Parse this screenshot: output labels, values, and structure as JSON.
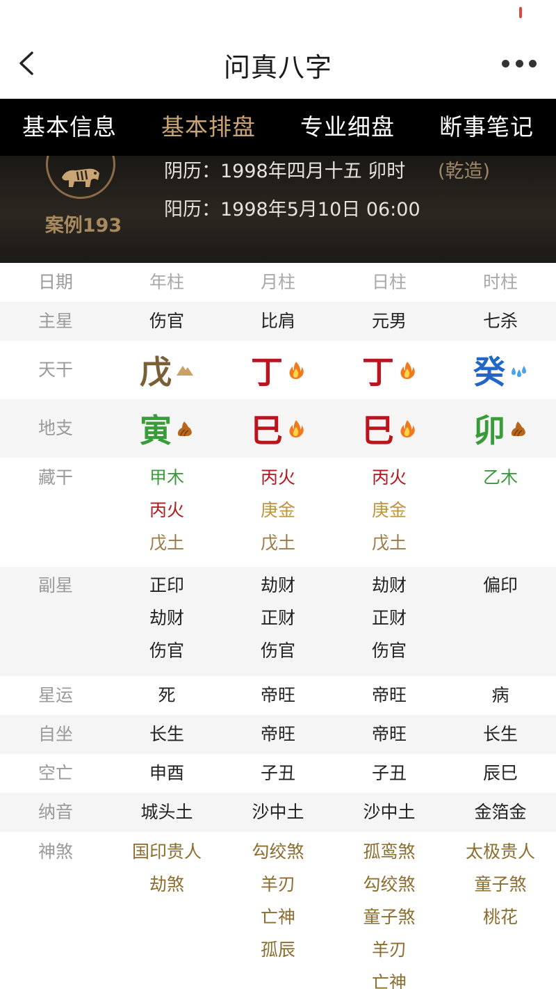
{
  "app": {
    "title": "问真八字"
  },
  "tabs": [
    {
      "label": "基本信息",
      "active": false
    },
    {
      "label": "基本排盘",
      "active": true
    },
    {
      "label": "专业细盘",
      "active": false
    },
    {
      "label": "断事笔记",
      "active": false
    }
  ],
  "header": {
    "case_label": "案例193",
    "lunar_label": "阴历：",
    "lunar_value": "1998年四月十五 卯时",
    "gender": "(乾造)",
    "solar_label": "阳历：",
    "solar_value": "1998年5月10日 06:00"
  },
  "table": {
    "columns_label": "日期",
    "columns": [
      "年柱",
      "月柱",
      "日柱",
      "时柱"
    ],
    "main_star": {
      "label": "主星",
      "values": [
        "伤官",
        "比肩",
        "元男",
        "七杀"
      ]
    },
    "tiangan": {
      "label": "天干",
      "values": [
        {
          "char": "戊",
          "element": "earth",
          "icon": "mountain-icon"
        },
        {
          "char": "丁",
          "element": "fire",
          "icon": "fire-icon"
        },
        {
          "char": "丁",
          "element": "fire",
          "icon": "fire-icon"
        },
        {
          "char": "癸",
          "element": "water",
          "icon": "water-drops-icon"
        }
      ]
    },
    "dizhi": {
      "label": "地支",
      "values": [
        {
          "char": "寅",
          "element": "wood",
          "icon": "wood-icon"
        },
        {
          "char": "巳",
          "element": "fire",
          "icon": "fire-icon"
        },
        {
          "char": "巳",
          "element": "fire",
          "icon": "fire-icon"
        },
        {
          "char": "卯",
          "element": "wood",
          "icon": "wood-icon"
        }
      ]
    },
    "hidden_stems": {
      "label": "藏干",
      "values": [
        [
          {
            "text": "甲木",
            "element": "wood"
          },
          {
            "text": "丙火",
            "element": "fire"
          },
          {
            "text": "戊土",
            "element": "earth"
          }
        ],
        [
          {
            "text": "丙火",
            "element": "fire"
          },
          {
            "text": "庚金",
            "element": "metal"
          },
          {
            "text": "戊土",
            "element": "earth"
          }
        ],
        [
          {
            "text": "丙火",
            "element": "fire"
          },
          {
            "text": "庚金",
            "element": "metal"
          },
          {
            "text": "戊土",
            "element": "earth"
          }
        ],
        [
          {
            "text": "乙木",
            "element": "wood"
          }
        ]
      ]
    },
    "sub_stars": {
      "label": "副星",
      "values": [
        [
          "正印",
          "劫财",
          "伤官"
        ],
        [
          "劫财",
          "正财",
          "伤官"
        ],
        [
          "劫财",
          "正财",
          "伤官"
        ],
        [
          "偏印"
        ]
      ]
    },
    "star_luck": {
      "label": "星运",
      "values": [
        "死",
        "帝旺",
        "帝旺",
        "病"
      ]
    },
    "self_seat": {
      "label": "自坐",
      "values": [
        "长生",
        "帝旺",
        "帝旺",
        "长生"
      ]
    },
    "void": {
      "label": "空亡",
      "values": [
        "申酉",
        "子丑",
        "子丑",
        "辰巳"
      ]
    },
    "nayin": {
      "label": "纳音",
      "values": [
        "城头土",
        "沙中土",
        "沙中土",
        "金箔金"
      ]
    },
    "shensha": {
      "label": "神煞",
      "values": [
        [
          "国印贵人",
          "劫煞"
        ],
        [
          "勾绞煞",
          "羊刃",
          "亡神",
          "孤辰"
        ],
        [
          "孤鸾煞",
          "勾绞煞",
          "童子煞",
          "羊刃",
          "亡神"
        ],
        [
          "太极贵人",
          "童子煞",
          "桃花"
        ]
      ]
    }
  },
  "colors": {
    "wood": "#3a9b3a",
    "fire": "#b8161c",
    "earth": "#7a5f35",
    "metal": "#bf9440",
    "water": "#2266c8",
    "active_tab": "#c9a474",
    "shensha": "#8b6e2f"
  }
}
